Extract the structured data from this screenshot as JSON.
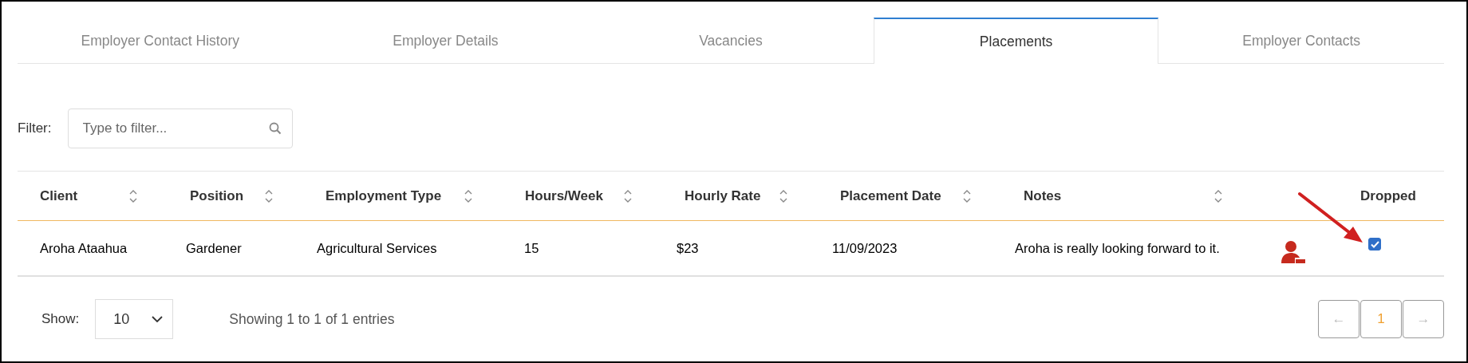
{
  "tabs": [
    {
      "label": "Employer Contact History",
      "selected": false
    },
    {
      "label": "Employer Details",
      "selected": false
    },
    {
      "label": "Vacancies",
      "selected": false
    },
    {
      "label": "Placements",
      "selected": true
    },
    {
      "label": "Employer Contacts",
      "selected": false
    }
  ],
  "filter": {
    "label": "Filter:",
    "placeholder": "Type to filter..."
  },
  "table": {
    "columns": [
      {
        "label": "Client",
        "sortable": true
      },
      {
        "label": "Position",
        "sortable": true
      },
      {
        "label": "Employment Type",
        "sortable": true
      },
      {
        "label": "Hours/Week",
        "sortable": true
      },
      {
        "label": "Hourly Rate",
        "sortable": true
      },
      {
        "label": "Placement Date",
        "sortable": true
      },
      {
        "label": "Notes",
        "sortable": true
      },
      {
        "label": "Dropped",
        "sortable": false
      }
    ],
    "rows": [
      {
        "client": "Aroha Ataahua",
        "position": "Gardener",
        "employment_type": "Agricultural Services",
        "hours_week": "15",
        "hourly_rate": "$23",
        "placement_date": "11/09/2023",
        "notes": "Aroha is really looking forward to it.",
        "dropped": true
      }
    ]
  },
  "footer": {
    "show_label": "Show:",
    "page_size": "10",
    "info": "Showing 1 to 1 of 1 entries"
  },
  "pagination": {
    "previous": "←",
    "pages": [
      {
        "label": "1",
        "selected": true
      }
    ],
    "next": "→"
  }
}
